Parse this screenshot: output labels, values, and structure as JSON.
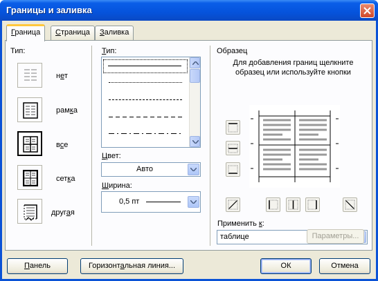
{
  "window": {
    "title": "Границы и заливка"
  },
  "tabs": [
    {
      "label": "Граница",
      "hot": "Г",
      "rest": "раница"
    },
    {
      "label": "Страница",
      "hot": "С",
      "rest": "траница"
    },
    {
      "label": "Заливка",
      "hot": "З",
      "rest": "аливка"
    }
  ],
  "type_section": {
    "label": "Тип:",
    "presets": [
      {
        "label": "нет",
        "pre": "н",
        "hot": "е",
        "post": "т",
        "icon": "no-border-icon"
      },
      {
        "label": "рамка",
        "pre": "рам",
        "hot": "к",
        "post": "а",
        "icon": "box-border-icon"
      },
      {
        "label": "все",
        "pre": "в",
        "hot": "с",
        "post": "е",
        "icon": "all-borders-icon"
      },
      {
        "label": "сетка",
        "pre": "сет",
        "hot": "к",
        "post": "а",
        "icon": "grid-border-icon"
      },
      {
        "label": "другая",
        "pre": "друг",
        "hot": "а",
        "post": "я",
        "icon": "custom-border-icon"
      }
    ]
  },
  "style_section": {
    "type_label": "Тип:",
    "color_label": "Цвет:",
    "color_value": "Авто",
    "width_label": "Ширина:",
    "width_value": "0,5 пт"
  },
  "preview": {
    "label": "Образец",
    "hint": "Для добавления границ щелкните образец или используйте кнопки"
  },
  "apply": {
    "label": "Применить к:",
    "value": "таблице",
    "params_button": "Параметры..."
  },
  "footer": {
    "panel_button": "Панель",
    "hline_button": "Горизонтальная линия...",
    "ok_button": "ОК",
    "cancel_button": "Отмена"
  },
  "colors": {
    "title_bar": "#0553dc",
    "dialog_bg": "#ece9d8",
    "accent_tab": "#ffc83c"
  }
}
